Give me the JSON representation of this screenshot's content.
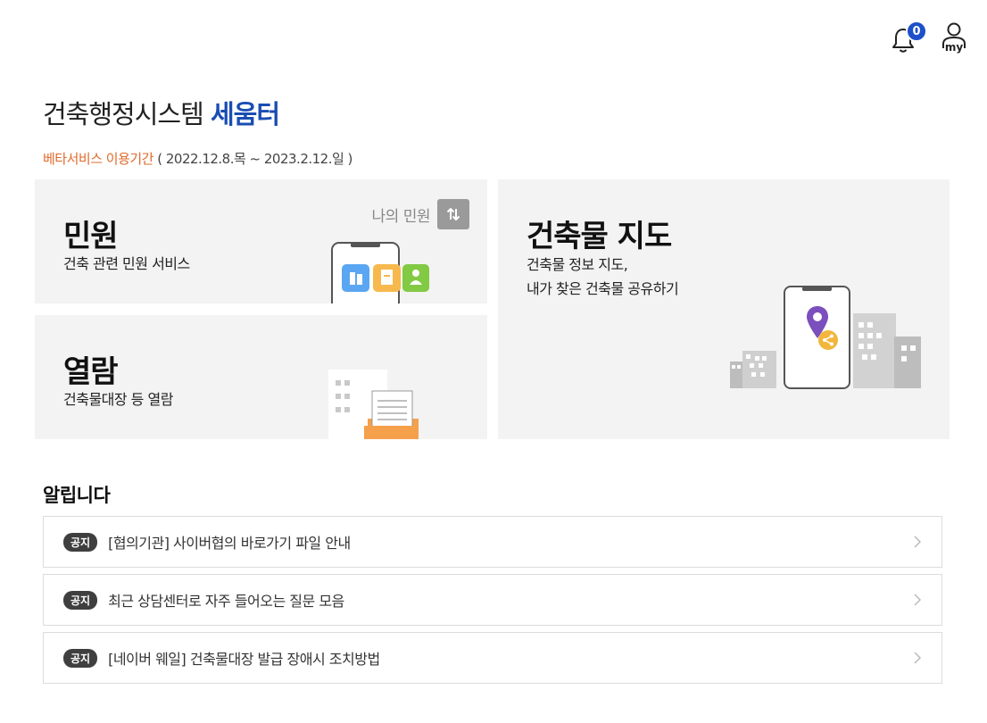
{
  "header": {
    "notification_count": "0",
    "my_label": "my"
  },
  "title": {
    "prefix": "건축행정시스템 ",
    "brand": "세움터"
  },
  "beta": {
    "label": "베타서비스 이용기간",
    "period": " ( 2022.12.8.목 ~ 2023.2.12.일 )"
  },
  "cards": {
    "minwon": {
      "title": "민원",
      "desc": "건축 관련 민원 서비스",
      "my_link": "나의 민원"
    },
    "yeolram": {
      "title": "열람",
      "desc": "건축물대장 등 열람"
    },
    "map": {
      "title": "건축물 지도",
      "desc_line1": "건축물 정보 지도,",
      "desc_line2": "내가 찾은 건축물 공유하기"
    }
  },
  "notices": {
    "heading": "알립니다",
    "tag": "공지",
    "items": [
      {
        "text": "[협의기관] 사이버협의 바로가기 파일 안내"
      },
      {
        "text": "최근 상담센터로 자주 들어오는 질문 모음"
      },
      {
        "text": "[네이버 웨일] 건축물대장 발급 장애시 조치방법"
      }
    ]
  },
  "colors": {
    "brand": "#1a4db3",
    "beta_accent": "#e06b2c",
    "badge": "#1d50c9",
    "card_bg": "#f3f3f3"
  },
  "icons": [
    "bell-icon",
    "user-icon",
    "swap-vertical-icon",
    "chevron-right-icon",
    "phone-illustration",
    "document-illustration",
    "map-pin-icon",
    "share-icon",
    "city-illustration"
  ]
}
